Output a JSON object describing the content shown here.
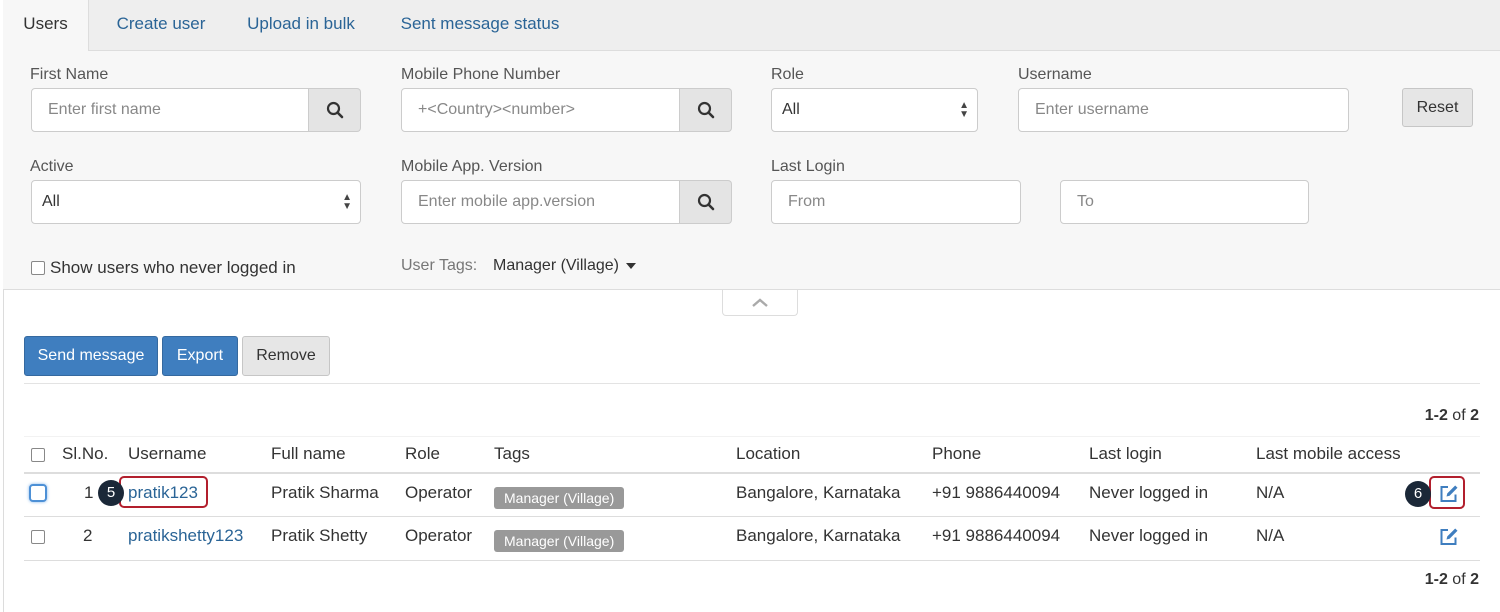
{
  "tabs": [
    {
      "label": "Users",
      "active": true
    },
    {
      "label": "Create user"
    },
    {
      "label": "Upload in bulk"
    },
    {
      "label": "Sent message status"
    }
  ],
  "filters": {
    "first_name": {
      "label": "First Name",
      "placeholder": "Enter first name"
    },
    "mobile_phone": {
      "label": "Mobile Phone Number",
      "placeholder": "+<Country><number>"
    },
    "role": {
      "label": "Role",
      "value": "All"
    },
    "username": {
      "label": "Username",
      "placeholder": "Enter username"
    },
    "reset_label": "Reset",
    "active": {
      "label": "Active",
      "value": "All"
    },
    "app_version": {
      "label": "Mobile App. Version",
      "placeholder": "Enter mobile app.version"
    },
    "last_login": {
      "label": "Last Login",
      "from_placeholder": "From",
      "to_placeholder": "To"
    },
    "never_logged_in_label": "Show users who never logged in",
    "user_tags_label": "User Tags:",
    "user_tags_value": "Manager (Village)"
  },
  "actions": {
    "send_message": "Send message",
    "export": "Export",
    "remove": "Remove"
  },
  "pagination": {
    "range": "1-2",
    "of": "of",
    "total": "2"
  },
  "table": {
    "headers": [
      "Sl.No.",
      "Username",
      "Full name",
      "Role",
      "Tags",
      "Location",
      "Phone",
      "Last login",
      "Last mobile access"
    ],
    "rows": [
      {
        "sl": "1",
        "username": "pratik123",
        "full_name": "Pratik Sharma",
        "role": "Operator",
        "tag": "Manager (Village)",
        "location": "Bangalore, Karnataka",
        "phone": "+91 9886440094",
        "last_login": "Never logged in",
        "last_mobile_access": "N/A"
      },
      {
        "sl": "2",
        "username": "pratikshetty123",
        "full_name": "Pratik Shetty",
        "role": "Operator",
        "tag": "Manager (Village)",
        "location": "Bangalore, Karnataka",
        "phone": "+91 9886440094",
        "last_login": "Never logged in",
        "last_mobile_access": "N/A"
      }
    ]
  },
  "callouts": {
    "username": "5",
    "edit": "6"
  },
  "icons": {
    "search": "search-icon",
    "edit": "edit-icon",
    "collapse": "chevron-up-icon",
    "caret": "caret-down-icon"
  },
  "colors": {
    "primary": "#3f7ebf",
    "link": "#2a6496",
    "tag": "#999999",
    "callout": "#b21f2d",
    "badge": "#1b2838"
  }
}
